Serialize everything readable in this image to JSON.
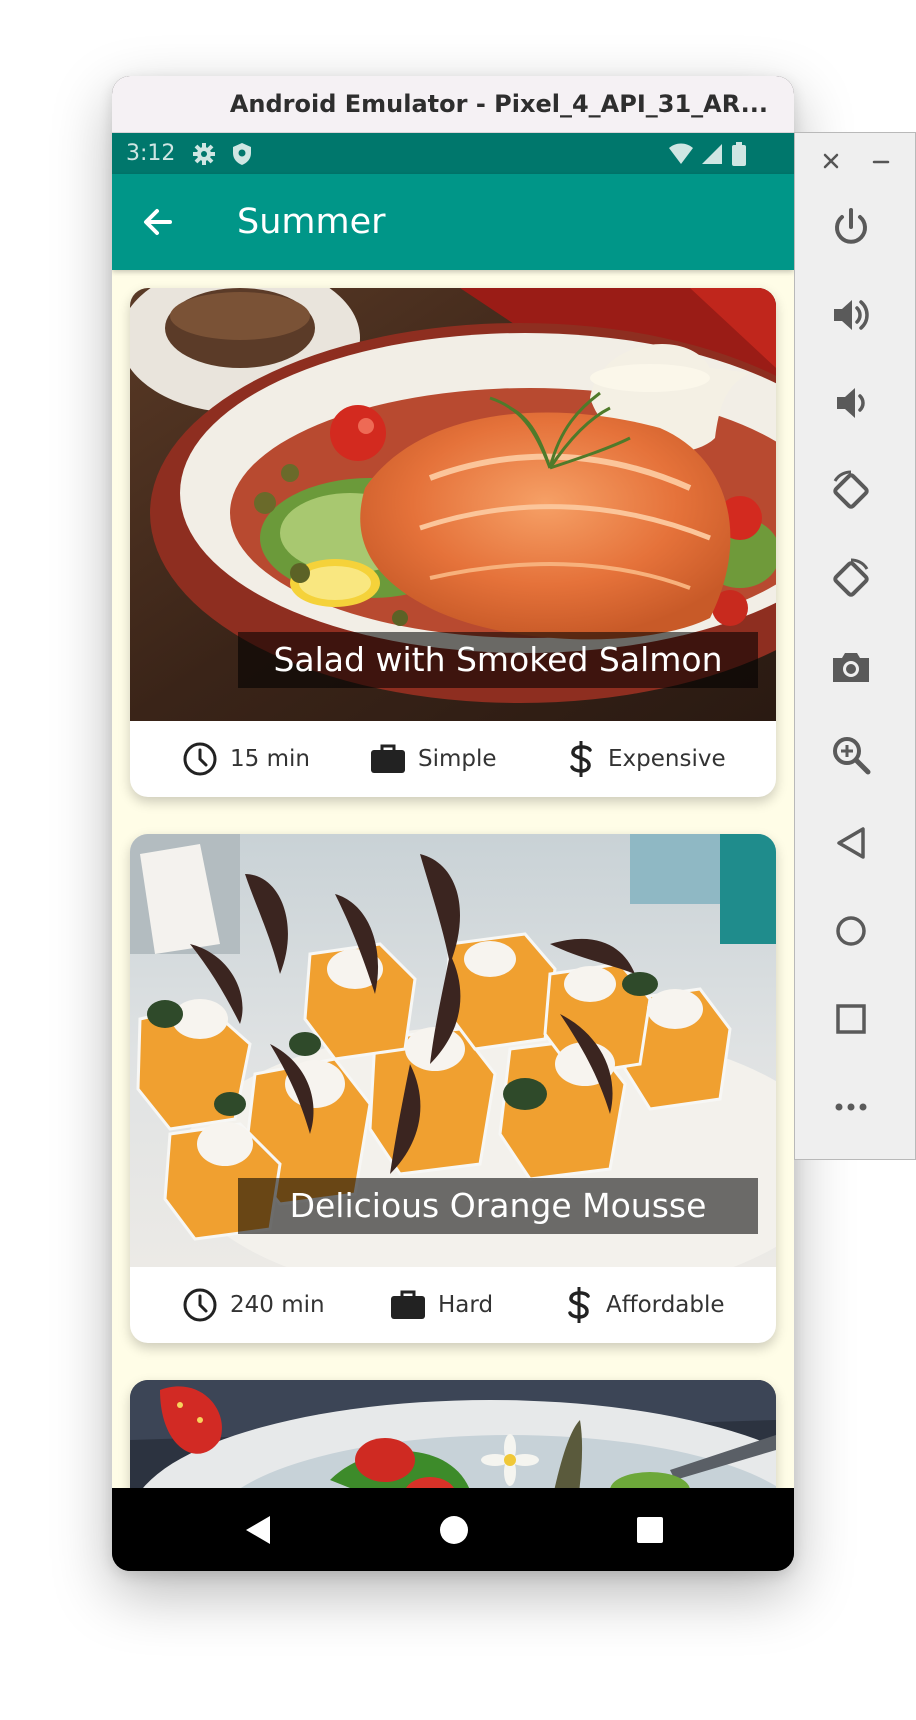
{
  "window": {
    "title": "Android Emulator - Pixel_4_API_31_AR..."
  },
  "status_bar": {
    "time": "3:12",
    "icons": [
      "settings-icon",
      "shield-icon",
      "wifi-icon",
      "signal-icon",
      "battery-icon"
    ]
  },
  "app_bar": {
    "title": "Summer",
    "back_icon": "arrow-back-icon",
    "color": "#009688"
  },
  "meals": [
    {
      "title": "Salad with Smoked Salmon",
      "duration": "15 min",
      "complexity": "Simple",
      "affordability": "Expensive"
    },
    {
      "title": "Delicious Orange Mousse",
      "duration": "240 min",
      "complexity": "Hard",
      "affordability": "Affordable"
    }
  ],
  "meta_icons": {
    "duration": "clock-icon",
    "complexity": "briefcase-icon",
    "affordability": "dollar-icon"
  },
  "emulator_toolbar": {
    "buttons": [
      "close-icon",
      "minimize-icon",
      "power-icon",
      "volume-up-icon",
      "volume-down-icon",
      "rotate-left-icon",
      "rotate-right-icon",
      "camera-icon",
      "zoom-icon",
      "back-icon",
      "home-icon",
      "overview-icon",
      "more-icon"
    ]
  },
  "nav_bar": {
    "buttons": [
      "nav-back-icon",
      "nav-home-icon",
      "nav-recents-icon"
    ]
  },
  "colors": {
    "accent": "#009688",
    "status_bar": "#00776c",
    "background": "#fffde7"
  }
}
